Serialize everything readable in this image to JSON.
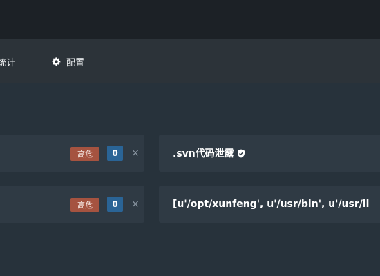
{
  "nav": {
    "stats_label": "统计",
    "config_label": "配置",
    "config_icon": "gear-icon"
  },
  "rows": [
    {
      "risk": "高危",
      "count": "0",
      "close": "×",
      "title": ".svn代码泄露",
      "title_icon": "shield-check-icon"
    },
    {
      "risk": "高危",
      "count": "0",
      "close": "×",
      "title": "[u'/opt/xunfeng', u'/usr/bin', u'/usr/li"
    }
  ],
  "colors": {
    "background": "#27323b",
    "navbar": "#2c3339",
    "panel": "#2f3a44",
    "risk_badge": "#a55340",
    "count_badge": "#2a6496"
  }
}
